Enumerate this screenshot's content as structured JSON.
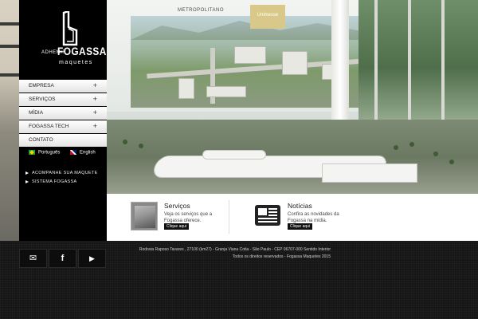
{
  "brand": {
    "pre": "ADHEMIR",
    "name": "FOGASSA",
    "tagline": "maquetes"
  },
  "menu": [
    {
      "label": "EMPRESA",
      "expand": "+"
    },
    {
      "label": "SERVIÇOS",
      "expand": "+"
    },
    {
      "label": "MÍDIA",
      "expand": "+"
    },
    {
      "label": "FOGASSA TECH",
      "expand": "+"
    },
    {
      "label": "CONTATO",
      "expand": ""
    }
  ],
  "languages": [
    {
      "label": "Português",
      "flag": "brazil-flag-icon"
    },
    {
      "label": "English",
      "flag": "uk-flag-icon"
    }
  ],
  "links": [
    {
      "label": "ACOMPANHE SUA MAQUETE"
    },
    {
      "label": "SISTEMA FOGASSA"
    }
  ],
  "hero": {
    "sign_left": "METROPOLITANO",
    "sign_right": "Unimesse"
  },
  "services": {
    "title": "Serviços",
    "text": "Veja os serviços que a Fogassa oferece.",
    "button": "Clique aqui"
  },
  "news": {
    "title": "Notícias",
    "text": "Confira as novidades da Fogassa na mídia.",
    "button": "Clique aqui"
  },
  "footer": {
    "address": "Rodovia Raposo Tavares , 27100 (km27) - Granja Viana Cotia - São Paulo - CEP 06707-000 Sentido Interior",
    "copyright": "Todos os direitos reservados - Fogassa Maquetes 2015",
    "social": [
      {
        "icon": "email-icon",
        "glyph": "✉"
      },
      {
        "icon": "facebook-icon",
        "glyph": "f"
      },
      {
        "icon": "play-icon",
        "glyph": "▶"
      }
    ]
  },
  "colors": {
    "sidebar": "#000000",
    "menu_bg": "#f0f0f0",
    "footer_bg": "#161616"
  }
}
